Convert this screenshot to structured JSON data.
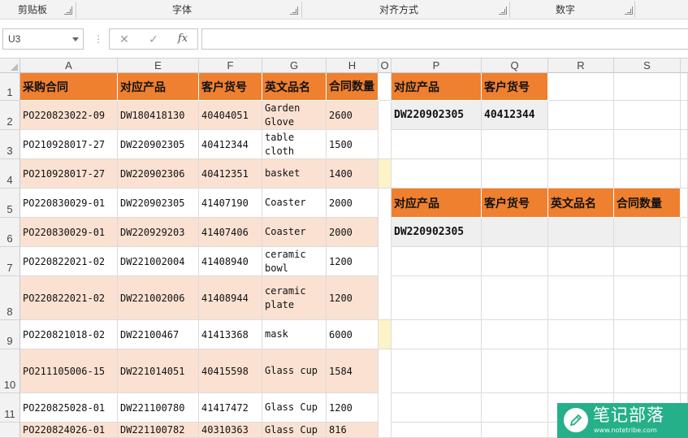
{
  "ribbon": {
    "groups": [
      "剪贴板",
      "字体",
      "对齐方式",
      "数字"
    ]
  },
  "formula_bar": {
    "name_box": "U3",
    "cancel_icon": "✕",
    "confirm_icon": "✓",
    "fx_label": "fx",
    "formula": ""
  },
  "columns": [
    "A",
    "E",
    "F",
    "G",
    "H",
    "O",
    "P",
    "Q",
    "R",
    "S"
  ],
  "rows": [
    "1",
    "2",
    "3",
    "4",
    "5",
    "6",
    "7",
    "8",
    "9",
    "10",
    "11"
  ],
  "main_table": {
    "headers": [
      "采购合同",
      "对应产品",
      "客户货号",
      "英文品名",
      "合同数量"
    ],
    "rows": [
      [
        "PO220823022-09",
        "DW180418130",
        "40404051",
        "Garden Glove",
        "2600"
      ],
      [
        "PO210928017-27",
        "DW220902305",
        "40412344",
        "table cloth",
        "1500"
      ],
      [
        "PO210928017-27",
        "DW220902306",
        "40412351",
        "basket",
        "1400"
      ],
      [
        "PO220830029-01",
        "DW220902305",
        "41407190",
        "Coaster",
        "2000"
      ],
      [
        "PO220830029-01",
        "DW220929203",
        "41407406",
        "Coaster",
        "2000"
      ],
      [
        "PO220822021-02",
        "DW221002004",
        "41408940",
        "ceramic bowl",
        "1200"
      ],
      [
        "PO220822021-02",
        "DW221002006",
        "41408944",
        "ceramic plate",
        "1200"
      ],
      [
        "PO220821018-02",
        "DW22100467",
        "41413368",
        "mask",
        "6000"
      ],
      [
        "PO211105006-15",
        "DW221014051",
        "40415598",
        "Glass cup",
        "1584"
      ],
      [
        "PO220825028-01",
        "DW221100780",
        "41417472",
        "Glass Cup",
        "1200"
      ],
      [
        "PO220824026-01",
        "DW221100782",
        "40310363",
        "Glass Cup",
        "816"
      ]
    ]
  },
  "lookup1": {
    "headers": [
      "对应产品",
      "客户货号"
    ],
    "values": [
      "DW220902305",
      "40412344"
    ]
  },
  "lookup2": {
    "headers": [
      "对应产品",
      "客户货号",
      "英文品名",
      "合同数量"
    ],
    "values": [
      "DW220902305"
    ]
  },
  "watermark": {
    "title": "笔记部落",
    "subtitle": "www.notetribe.com"
  },
  "colors": {
    "header_orange": "#ee8030",
    "row_peach": "#fbe1d2",
    "lookup_gray": "#efefef",
    "watermark_green": "#26b089"
  }
}
